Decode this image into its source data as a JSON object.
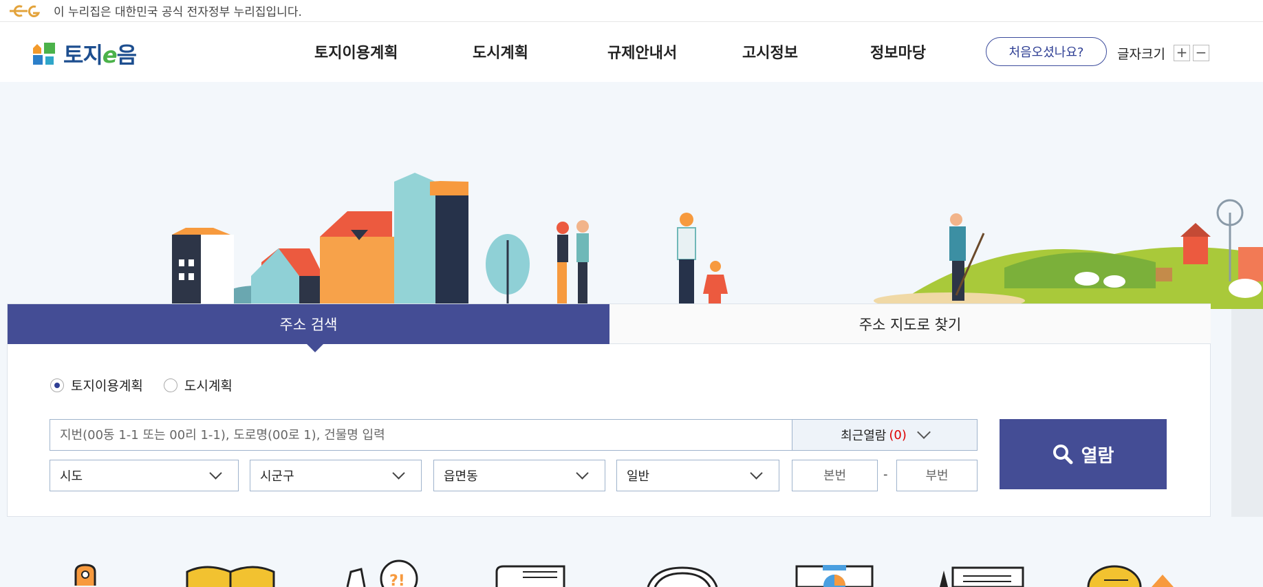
{
  "gov_banner": {
    "text": "이 누리집은 대한민국 공식 전자정부 누리집입니다."
  },
  "header": {
    "logo_text_a": "토지",
    "logo_text_e": "e",
    "logo_text_b": "음",
    "nav": [
      "토지이용계획",
      "도시계획",
      "규제안내서",
      "고시정보",
      "정보마당"
    ],
    "first_visit": "처음오셨나요?",
    "font_size_label": "글자크기",
    "font_plus": "+",
    "font_minus": "−"
  },
  "search": {
    "tabs": [
      "주소 검색",
      "주소 지도로 찾기"
    ],
    "radios": [
      "토지이용계획",
      "도시계획"
    ],
    "address_placeholder": "지번(00동 1-1 또는 00리 1-1), 도로명(00로 1), 건물명 입력",
    "recent_label": "최근열람",
    "recent_count": "(0)",
    "selects": [
      "시도",
      "시군구",
      "읍면동",
      "일반"
    ],
    "main_num_placeholder": "본번",
    "sub_num_placeholder": "부번",
    "dash": "-",
    "search_button": "열람"
  },
  "colors": {
    "primary": "#444d95",
    "logo_blue": "#1d4e8f",
    "logo_green": "#4bb24a",
    "count_red": "#dd0000"
  }
}
